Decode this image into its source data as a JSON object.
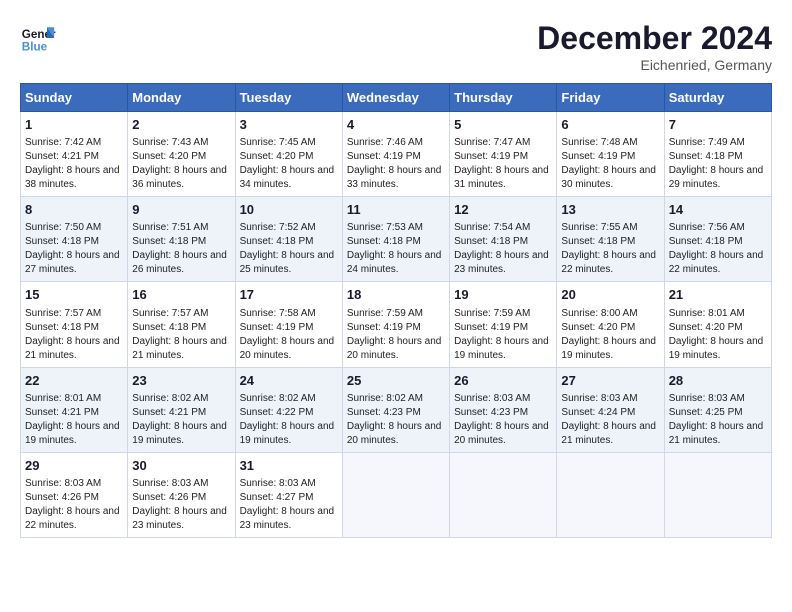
{
  "logo": {
    "line1": "General",
    "line2": "Blue"
  },
  "title": "December 2024",
  "location": "Eichenried, Germany",
  "days_of_week": [
    "Sunday",
    "Monday",
    "Tuesday",
    "Wednesday",
    "Thursday",
    "Friday",
    "Saturday"
  ],
  "weeks": [
    [
      {
        "day": "1",
        "sunrise": "7:42 AM",
        "sunset": "4:21 PM",
        "daylight": "8 hours and 38 minutes."
      },
      {
        "day": "2",
        "sunrise": "7:43 AM",
        "sunset": "4:20 PM",
        "daylight": "8 hours and 36 minutes."
      },
      {
        "day": "3",
        "sunrise": "7:45 AM",
        "sunset": "4:20 PM",
        "daylight": "8 hours and 34 minutes."
      },
      {
        "day": "4",
        "sunrise": "7:46 AM",
        "sunset": "4:19 PM",
        "daylight": "8 hours and 33 minutes."
      },
      {
        "day": "5",
        "sunrise": "7:47 AM",
        "sunset": "4:19 PM",
        "daylight": "8 hours and 31 minutes."
      },
      {
        "day": "6",
        "sunrise": "7:48 AM",
        "sunset": "4:19 PM",
        "daylight": "8 hours and 30 minutes."
      },
      {
        "day": "7",
        "sunrise": "7:49 AM",
        "sunset": "4:18 PM",
        "daylight": "8 hours and 29 minutes."
      }
    ],
    [
      {
        "day": "8",
        "sunrise": "7:50 AM",
        "sunset": "4:18 PM",
        "daylight": "8 hours and 27 minutes."
      },
      {
        "day": "9",
        "sunrise": "7:51 AM",
        "sunset": "4:18 PM",
        "daylight": "8 hours and 26 minutes."
      },
      {
        "day": "10",
        "sunrise": "7:52 AM",
        "sunset": "4:18 PM",
        "daylight": "8 hours and 25 minutes."
      },
      {
        "day": "11",
        "sunrise": "7:53 AM",
        "sunset": "4:18 PM",
        "daylight": "8 hours and 24 minutes."
      },
      {
        "day": "12",
        "sunrise": "7:54 AM",
        "sunset": "4:18 PM",
        "daylight": "8 hours and 23 minutes."
      },
      {
        "day": "13",
        "sunrise": "7:55 AM",
        "sunset": "4:18 PM",
        "daylight": "8 hours and 22 minutes."
      },
      {
        "day": "14",
        "sunrise": "7:56 AM",
        "sunset": "4:18 PM",
        "daylight": "8 hours and 22 minutes."
      }
    ],
    [
      {
        "day": "15",
        "sunrise": "7:57 AM",
        "sunset": "4:18 PM",
        "daylight": "8 hours and 21 minutes."
      },
      {
        "day": "16",
        "sunrise": "7:57 AM",
        "sunset": "4:18 PM",
        "daylight": "8 hours and 21 minutes."
      },
      {
        "day": "17",
        "sunrise": "7:58 AM",
        "sunset": "4:19 PM",
        "daylight": "8 hours and 20 minutes."
      },
      {
        "day": "18",
        "sunrise": "7:59 AM",
        "sunset": "4:19 PM",
        "daylight": "8 hours and 20 minutes."
      },
      {
        "day": "19",
        "sunrise": "7:59 AM",
        "sunset": "4:19 PM",
        "daylight": "8 hours and 19 minutes."
      },
      {
        "day": "20",
        "sunrise": "8:00 AM",
        "sunset": "4:20 PM",
        "daylight": "8 hours and 19 minutes."
      },
      {
        "day": "21",
        "sunrise": "8:01 AM",
        "sunset": "4:20 PM",
        "daylight": "8 hours and 19 minutes."
      }
    ],
    [
      {
        "day": "22",
        "sunrise": "8:01 AM",
        "sunset": "4:21 PM",
        "daylight": "8 hours and 19 minutes."
      },
      {
        "day": "23",
        "sunrise": "8:02 AM",
        "sunset": "4:21 PM",
        "daylight": "8 hours and 19 minutes."
      },
      {
        "day": "24",
        "sunrise": "8:02 AM",
        "sunset": "4:22 PM",
        "daylight": "8 hours and 19 minutes."
      },
      {
        "day": "25",
        "sunrise": "8:02 AM",
        "sunset": "4:23 PM",
        "daylight": "8 hours and 20 minutes."
      },
      {
        "day": "26",
        "sunrise": "8:03 AM",
        "sunset": "4:23 PM",
        "daylight": "8 hours and 20 minutes."
      },
      {
        "day": "27",
        "sunrise": "8:03 AM",
        "sunset": "4:24 PM",
        "daylight": "8 hours and 21 minutes."
      },
      {
        "day": "28",
        "sunrise": "8:03 AM",
        "sunset": "4:25 PM",
        "daylight": "8 hours and 21 minutes."
      }
    ],
    [
      {
        "day": "29",
        "sunrise": "8:03 AM",
        "sunset": "4:26 PM",
        "daylight": "8 hours and 22 minutes."
      },
      {
        "day": "30",
        "sunrise": "8:03 AM",
        "sunset": "4:26 PM",
        "daylight": "8 hours and 23 minutes."
      },
      {
        "day": "31",
        "sunrise": "8:03 AM",
        "sunset": "4:27 PM",
        "daylight": "8 hours and 23 minutes."
      },
      null,
      null,
      null,
      null
    ]
  ],
  "labels": {
    "sunrise": "Sunrise:",
    "sunset": "Sunset:",
    "daylight": "Daylight:"
  }
}
